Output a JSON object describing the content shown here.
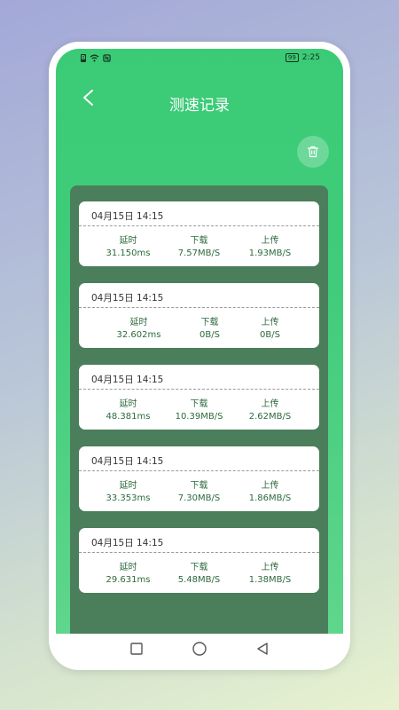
{
  "status_bar": {
    "time": "2:25",
    "battery": "99"
  },
  "header": {
    "title": "测速记录",
    "back_icon": "chevron-left-icon"
  },
  "toolbar": {
    "delete_icon": "trash-icon"
  },
  "colors": {
    "accent": "#3bcb76",
    "panel": "#4b7e5b",
    "value_text": "#2c6a3d"
  },
  "records": [
    {
      "date": "04月15日 14:15",
      "latency_label": "延时",
      "latency": "31.150ms",
      "download_label": "下载",
      "download": "7.57MB/S",
      "upload_label": "上传",
      "upload": "1.93MB/S"
    },
    {
      "date": "04月15日 14:15",
      "latency_label": "延时",
      "latency": "32.602ms",
      "download_label": "下载",
      "download": "0B/S",
      "upload_label": "上传",
      "upload": "0B/S"
    },
    {
      "date": "04月15日 14:15",
      "latency_label": "延时",
      "latency": "48.381ms",
      "download_label": "下载",
      "download": "10.39MB/S",
      "upload_label": "上传",
      "upload": "2.62MB/S"
    },
    {
      "date": "04月15日 14:15",
      "latency_label": "延时",
      "latency": "33.353ms",
      "download_label": "下载",
      "download": "7.30MB/S",
      "upload_label": "上传",
      "upload": "1.86MB/S"
    },
    {
      "date": "04月15日 14:15",
      "latency_label": "延时",
      "latency": "29.631ms",
      "download_label": "下载",
      "download": "5.48MB/S",
      "upload_label": "上传",
      "upload": "1.38MB/S"
    }
  ]
}
